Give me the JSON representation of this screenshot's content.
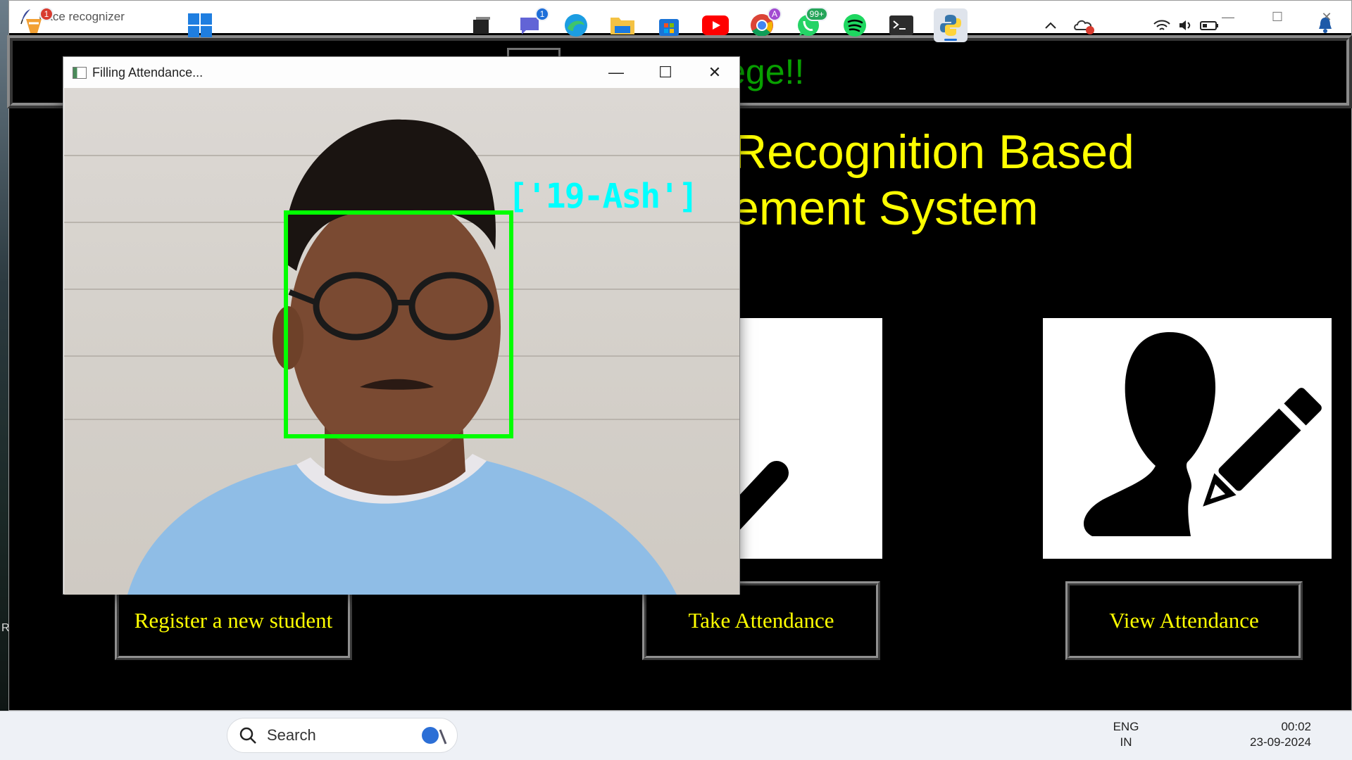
{
  "main_window": {
    "title": "Face recognizer",
    "controls": {
      "minimize": "—",
      "maximize": "☐",
      "close": "✕"
    }
  },
  "banner": {
    "text": "lege!!",
    "color": "#08a000"
  },
  "heading": {
    "line1": "Recognition Based",
    "line2": "ement System",
    "color": "#ffff00"
  },
  "buttons": {
    "register": "Register a new student",
    "take": "Take Attendance",
    "view": "View Attendance"
  },
  "opencv_window": {
    "title": "Filling Attendance...",
    "controls": {
      "minimize": "—",
      "maximize": "☐",
      "close": "✕"
    },
    "detection_label": "['19-Ash']",
    "box_color": "#00ff00",
    "label_color": "#00ffff"
  },
  "taskbar": {
    "search_placeholder": "Search",
    "widgets_badge": "1",
    "teams_badge": "1",
    "whatsapp_badge": "99+",
    "chrome_profile": "A",
    "language_line1": "ENG",
    "language_line2": "IN",
    "time": "00:02",
    "date": "23-09-2024"
  },
  "desktop_edge_letter": "R"
}
